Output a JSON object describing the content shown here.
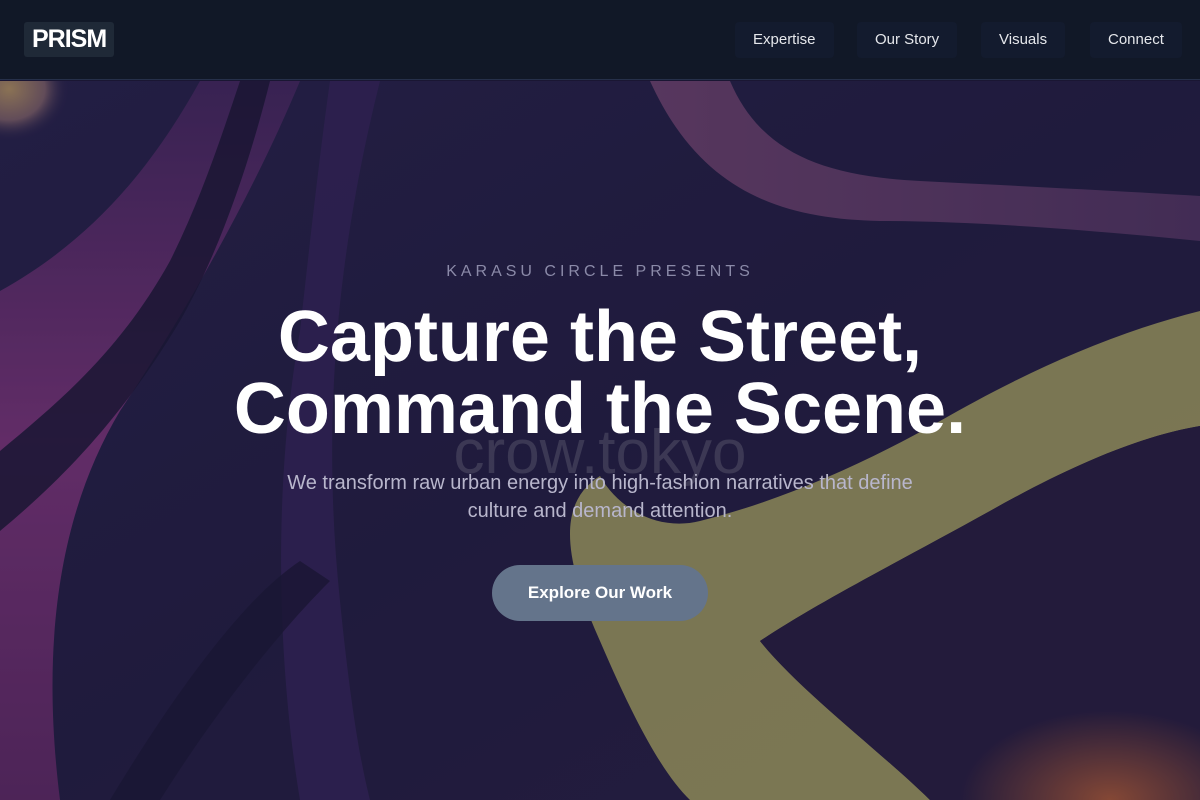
{
  "header": {
    "logo": "PRISM",
    "nav": [
      {
        "label": "Expertise"
      },
      {
        "label": "Our Story"
      },
      {
        "label": "Visuals"
      },
      {
        "label": "Connect"
      }
    ]
  },
  "hero": {
    "eyebrow": "KARASU CIRCLE PRESENTS",
    "headline_line1": "Capture the Street,",
    "headline_line2": "Command the Scene.",
    "watermark": "crow.tokyo",
    "subtext": "We transform raw urban energy into high-fashion narratives that define culture and demand attention.",
    "cta_label": "Explore Our Work"
  },
  "colors": {
    "nav_bg": "#111827",
    "button_bg": "#64748b",
    "accent_yellow": "#c9c46e",
    "accent_magenta": "#8a3a86"
  }
}
